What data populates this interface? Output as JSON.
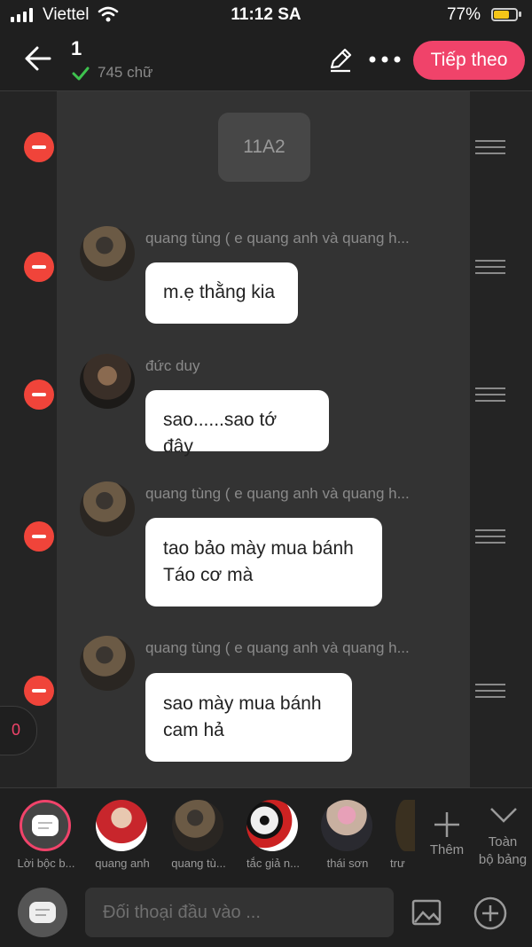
{
  "status_bar": {
    "carrier": "Viettel",
    "time": "11:12 SA",
    "battery_percent": "77%",
    "battery_level": 0.77
  },
  "header": {
    "title": "1",
    "word_count": "745 chữ",
    "next_label": "Tiếp theo"
  },
  "story": {
    "narration": "11A2",
    "messages": [
      {
        "name": "quang tùng ( e quang anh và quang h...",
        "text_lines": [
          "m.ẹ thằng kia"
        ]
      },
      {
        "name": "đức duy",
        "text_lines": [
          "sao......sao tớ đây"
        ]
      },
      {
        "name": "quang tùng ( e quang anh và quang h...",
        "text_lines": [
          "tao bảo mày mua bánh",
          "Táo cơ mà"
        ]
      },
      {
        "name": "quang tùng ( e quang anh và quang h...",
        "text_lines": [
          "sao mày mua bánh",
          "cam hả"
        ]
      }
    ],
    "side_badge": "0"
  },
  "characters": [
    {
      "label": "Lời bộc b...",
      "icon": "narration-icon"
    },
    {
      "label": "quang anh",
      "icon": "avatar"
    },
    {
      "label": "quang tù...",
      "icon": "avatar"
    },
    {
      "label": "tắc giả n...",
      "icon": "avatar"
    },
    {
      "label": "thái sơn",
      "icon": "avatar"
    },
    {
      "label": "trư",
      "icon": "avatar"
    }
  ],
  "add_label": "Thêm",
  "collapse_label": [
    "Toàn",
    "bộ bảng"
  ],
  "input": {
    "placeholder": "Đối thoại đầu vào ..."
  },
  "colors": {
    "accent": "#f0436a",
    "delete": "#f0443a",
    "background": "#2a2a2a"
  }
}
